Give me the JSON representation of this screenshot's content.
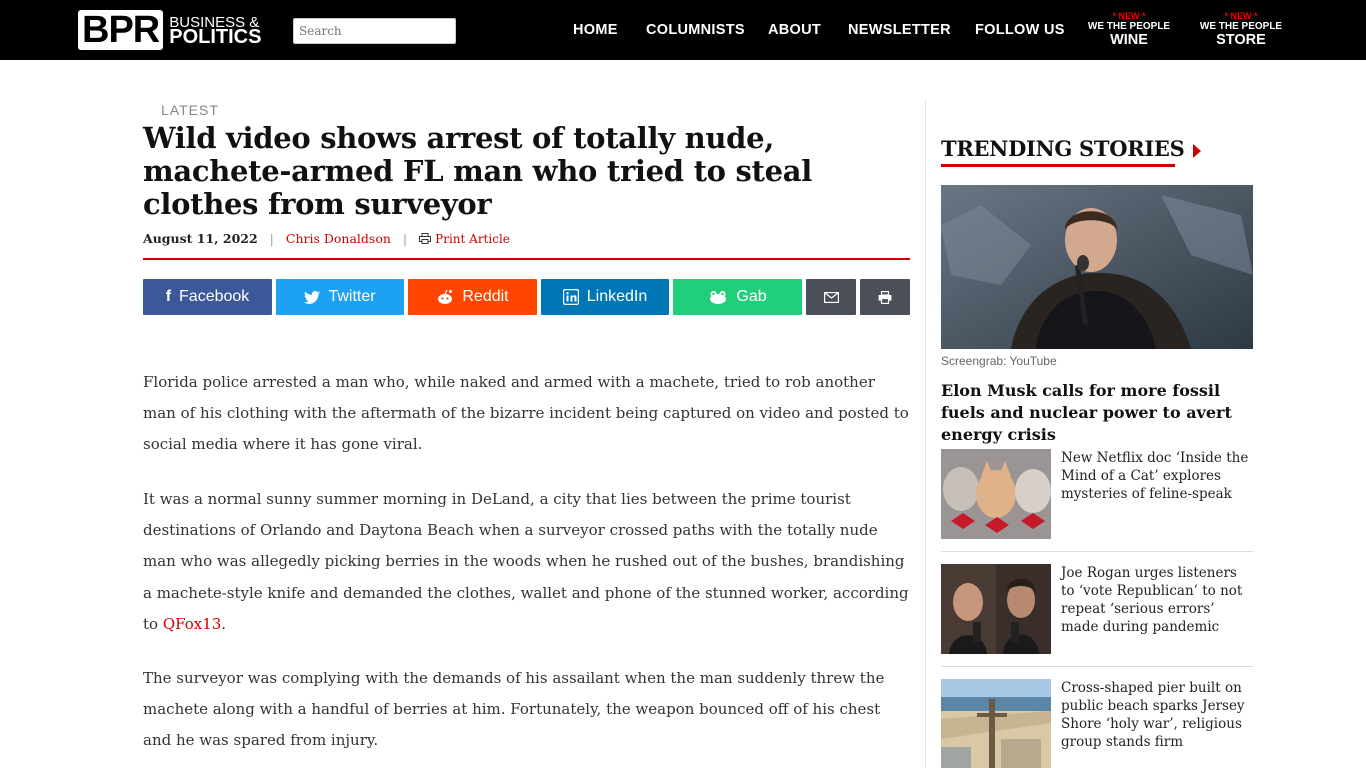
{
  "header": {
    "logo_mark": "BPR",
    "logo_line1": "BUSINESS &",
    "logo_line2": "POLITICS",
    "search_placeholder": "Search",
    "nav": [
      "HOME",
      "COLUMNISTS",
      "ABOUT",
      "NEWSLETTER",
      "FOLLOW US"
    ],
    "wine": {
      "badge": "* NEW *",
      "sub": "WE THE PEOPLE",
      "label": "WINE"
    },
    "store": {
      "badge": "* NEW *",
      "sub": "WE THE PEOPLE",
      "label": "STORE"
    }
  },
  "article": {
    "category": "LATEST",
    "title": "Wild video shows arrest of totally nude, machete-armed FL man who tried to steal clothes from surveyor",
    "date": "August 11, 2022",
    "separator": "|",
    "author": "Chris Donaldson",
    "print_label": "Print Article",
    "share": {
      "facebook": "Facebook",
      "twitter": "Twitter",
      "reddit": "Reddit",
      "linkedin": "LinkedIn",
      "gab": "Gab"
    },
    "p1": "Florida police arrested a man who, while naked and armed with a machete, tried to rob another man of his clothing with the aftermath of the bizarre incident being captured on video and posted to social media where it has gone viral.",
    "p2_text": "It was a normal sunny summer morning in DeLand, a city that lies between the prime tourist destinations of Orlando and Daytona Beach when a surveyor crossed paths with the totally nude man who was allegedly picking berries in the woods when he rushed out of the bushes, brandishing a machete-style knife and demanded the clothes, wallet and phone of the stunned worker, according to ",
    "p2_link": "QFox13",
    "p2_end": ".",
    "p3": "The surveyor was complying with the demands of his assailant when the man suddenly threw the machete along with a handful of berries at him. Fortunately, the weapon bounced off of his chest and he was spared from injury."
  },
  "sidebar": {
    "title": "TRENDING STORIES",
    "hero_caption": "Screengrab: YouTube",
    "hero_headline": "Elon Musk calls for more fossil fuels and nuclear power to avert energy crisis",
    "stories": [
      {
        "headline": "New Netflix doc ‘Inside the Mind of a Cat’ explores mysteries of feline-speak"
      },
      {
        "headline": "Joe Rogan urges listeners to ‘vote Republican’ to not repeat ‘serious errors’ made during pandemic"
      },
      {
        "headline": "Cross-shaped pier built on public beach sparks Jersey Shore ‘holy war’, religious group stands firm"
      }
    ]
  },
  "colors": {
    "accent": "#cc0000",
    "facebook": "#3b5998",
    "twitter": "#1da1f2",
    "reddit": "#ff4500",
    "linkedin": "#0077b5",
    "gab": "#21cf7b",
    "utility": "#4a4f58"
  }
}
